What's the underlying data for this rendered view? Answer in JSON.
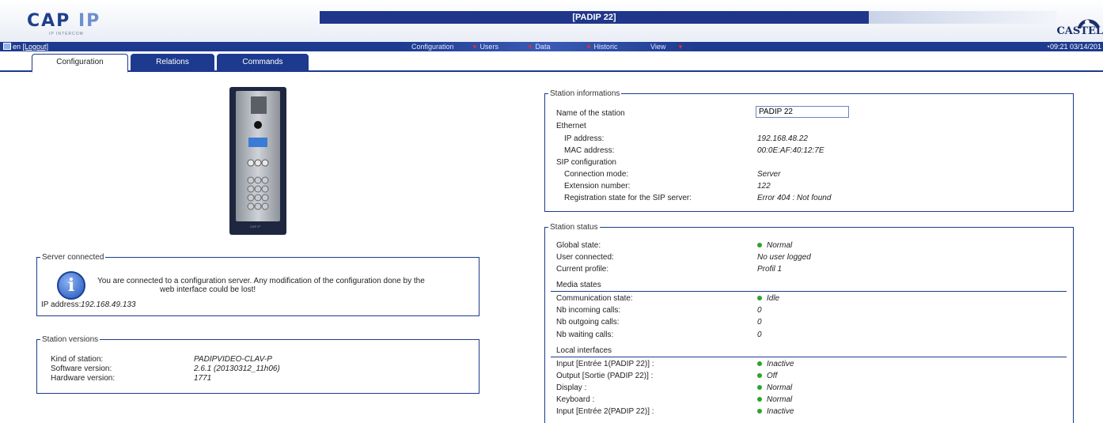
{
  "header": {
    "logo_main": "CAP",
    "logo_accent": "IP",
    "logo_sub": "IP INTERCOM",
    "title": "[PADIP 22]",
    "brand": "CASTEL"
  },
  "menubar": {
    "language": "en",
    "logout": "[Logout]",
    "items": [
      "Configuration",
      "Users",
      "Data",
      "Historic",
      "View"
    ],
    "clock": "09:21 03/14/201"
  },
  "tabs": [
    "Configuration",
    "Relations",
    "Commands"
  ],
  "server": {
    "legend": "Server connected",
    "message_line1": "You are connected to a configuration server. Any modification of the configuration done by the",
    "message_line2": "web interface could be lost!",
    "ip_label": "IP address:",
    "ip_value": "192.168.49.133"
  },
  "versions": {
    "legend": "Station versions",
    "rows": [
      {
        "label": "Kind of station:",
        "value": "PADIPVIDEO-CLAV-P"
      },
      {
        "label": "Software version:",
        "value": "2.6.1 (20130312_11h06)"
      },
      {
        "label": "Hardware version:",
        "value": "1771"
      }
    ]
  },
  "device": {
    "label": "CAP IP"
  },
  "station_info": {
    "legend": "Station informations",
    "name_label": "Name of the station",
    "name_value": "PADIP 22",
    "ethernet": "Ethernet",
    "ip_label": "IP address:",
    "ip_value": "192.168.48.22",
    "mac_label": "MAC address:",
    "mac_value": "00:0E:AF:40:12:7E",
    "sip": "SIP configuration",
    "conn_label": "Connection mode:",
    "conn_value": "Server",
    "ext_label": "Extension number:",
    "ext_value": "122",
    "reg_label": "Registration state for the SIP server:",
    "reg_value": "Error 404 : Not found"
  },
  "station_status": {
    "legend": "Station status",
    "global_label": "Global state:",
    "global_value": "Normal",
    "user_label": "User connected:",
    "user_value": "No user logged",
    "profile_label": "Current profile:",
    "profile_value": "Profil 1",
    "media_title": "Media states",
    "comm_label": "Communication state:",
    "comm_value": "Idle",
    "in_label": "Nb incoming calls:",
    "in_value": "0",
    "out_label": "Nb outgoing calls:",
    "out_value": "0",
    "wait_label": "Nb waiting calls:",
    "wait_value": "0",
    "local_title": "Local interfaces",
    "interfaces": [
      {
        "label": "Input [Entrée 1(PADIP 22)] :",
        "value": "Inactive"
      },
      {
        "label": "Output [Sortie (PADIP 22)] :",
        "value": "Off"
      },
      {
        "label": "Display :",
        "value": "Normal"
      },
      {
        "label": "Keyboard :",
        "value": "Normal"
      },
      {
        "label": "Input [Entrée 2(PADIP 22)] :",
        "value": "Inactive"
      }
    ]
  },
  "colors": {
    "brand": "#1d3a8e",
    "ok": "#2aa52a",
    "alert_arrow": "#e03030"
  }
}
